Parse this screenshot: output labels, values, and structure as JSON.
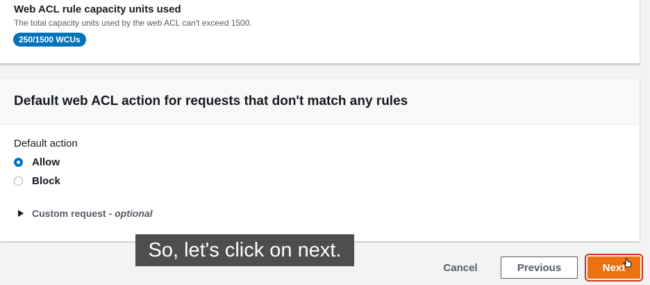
{
  "capacity": {
    "title": "Web ACL rule capacity units used",
    "description": "The total capacity units used by the web ACL can't exceed 1500.",
    "badge": "250/1500 WCUs"
  },
  "default_action_section": {
    "title": "Default web ACL action for requests that don't match any rules",
    "field_label": "Default action",
    "options": [
      {
        "label": "Allow",
        "selected": true
      },
      {
        "label": "Block",
        "selected": false
      }
    ],
    "expander": {
      "label": "Custom request -",
      "optional": "optional"
    }
  },
  "caption": "So, let's click on next.",
  "footer": {
    "cancel_label": "Cancel",
    "previous_label": "Previous",
    "next_label": "Next"
  },
  "colors": {
    "primary_orange": "#ec7211",
    "badge_blue": "#0073bb"
  }
}
